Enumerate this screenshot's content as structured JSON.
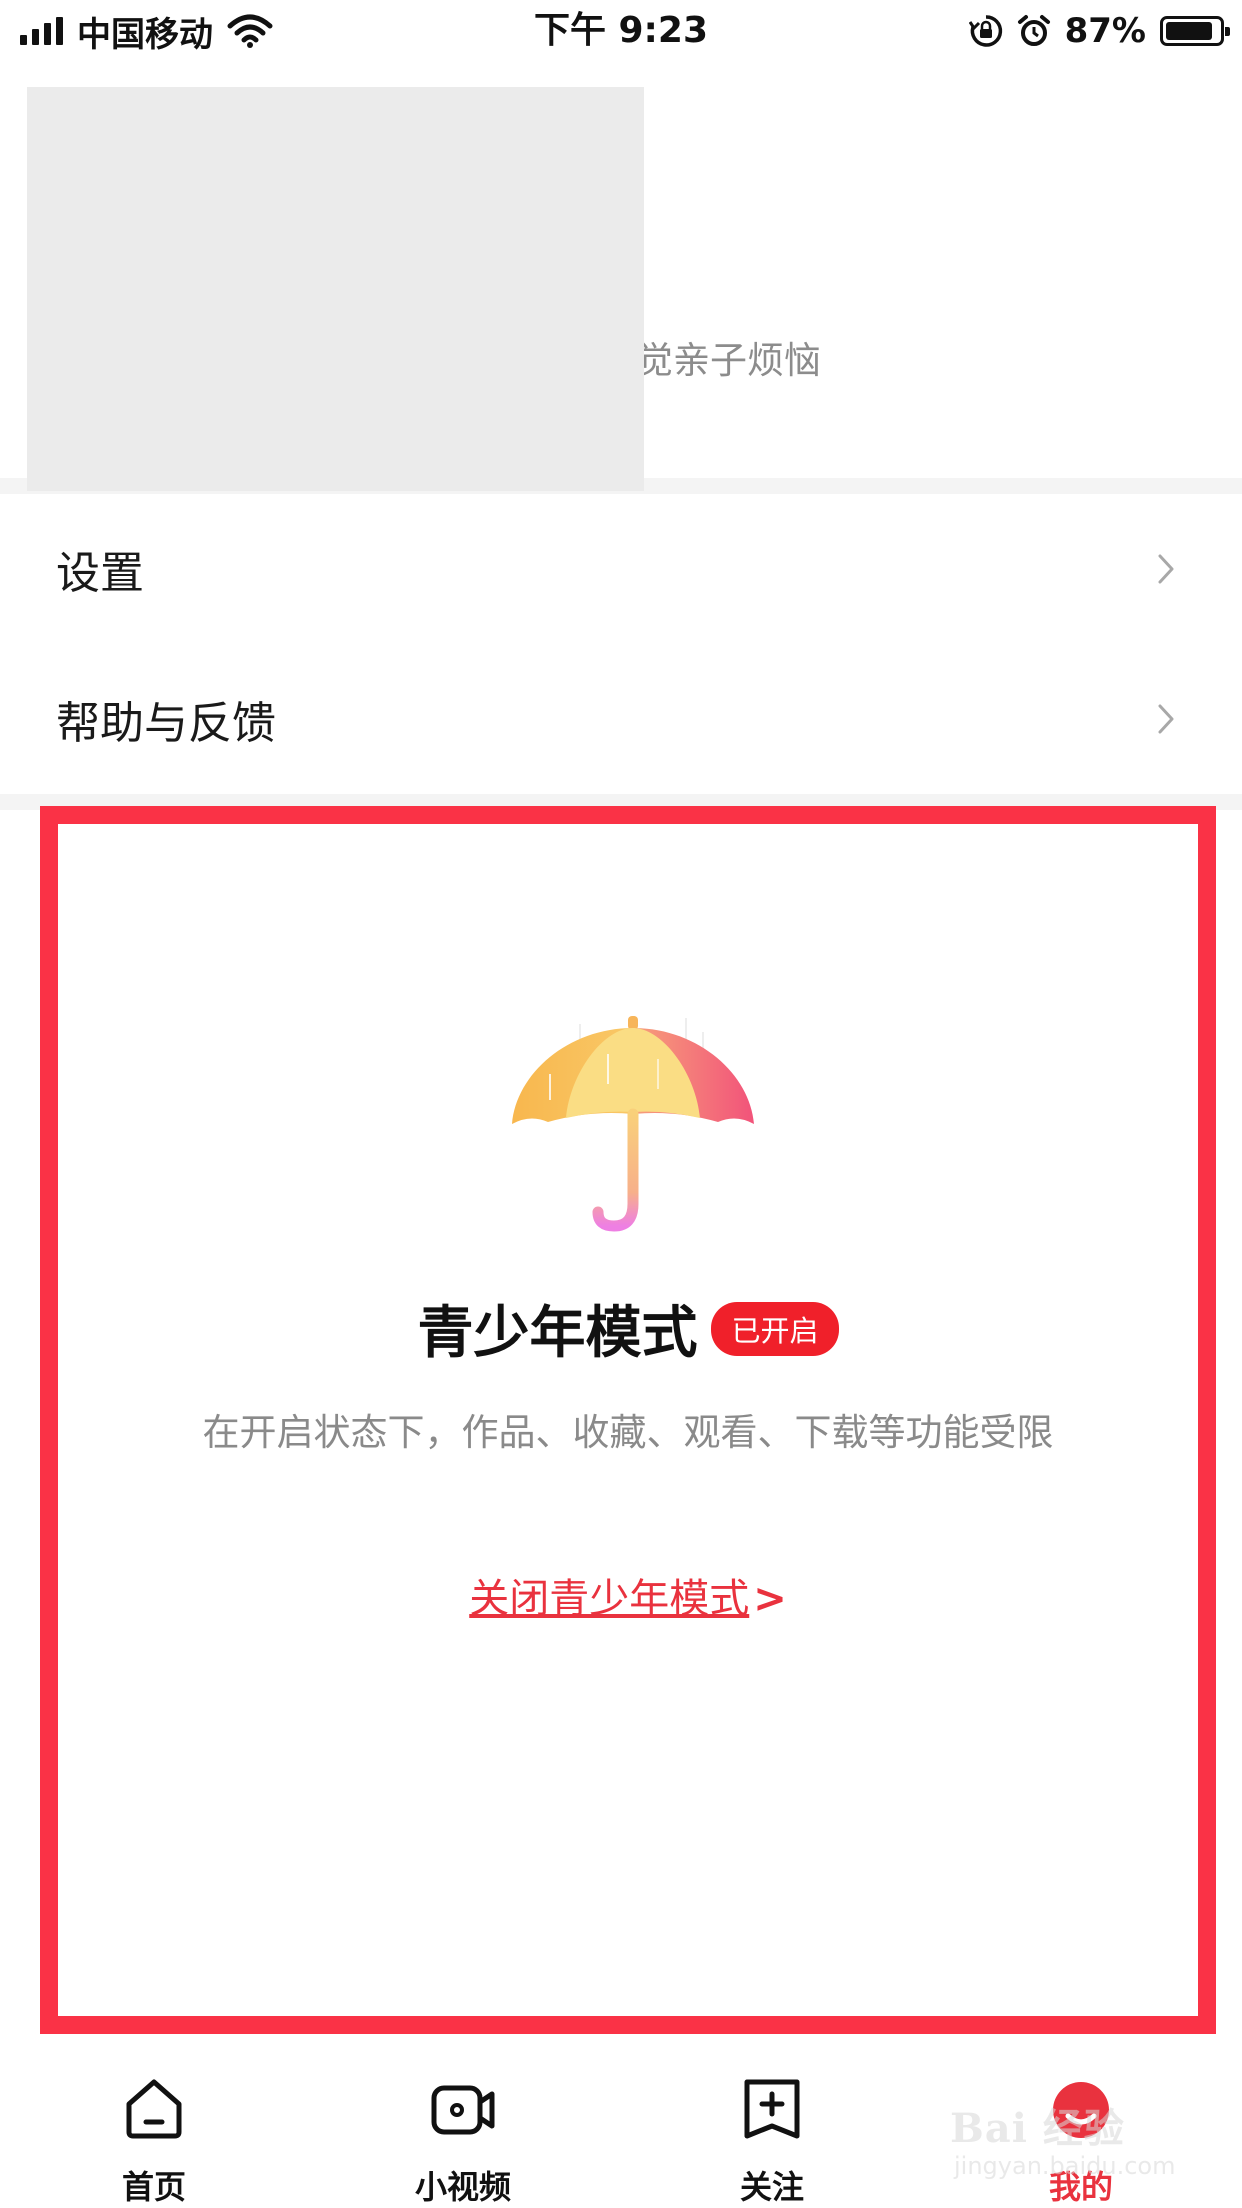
{
  "status_bar": {
    "carrier": "中国移动",
    "time": "下午 9:23",
    "battery_percent": "87%",
    "battery_level": 0.87,
    "icons": [
      "signal-icon",
      "wifi-icon",
      "orientation-lock-icon",
      "alarm-icon",
      "battery-icon"
    ]
  },
  "profile": {
    "bio_visible_text": "觉亲子烦恼"
  },
  "menu": {
    "items": [
      {
        "label": "设置",
        "icon": "chevron-right-icon"
      },
      {
        "label": "帮助与反馈",
        "icon": "chevron-right-icon"
      }
    ]
  },
  "teen_mode": {
    "icon": "umbrella-icon",
    "title": "青少年模式",
    "badge": "已开启",
    "description": "在开启状态下，作品、收藏、观看、下载等功能受限",
    "close_link": "关闭青少年模式",
    "close_arrow": ">",
    "highlight_color": "#fa3246"
  },
  "tabbar": {
    "tabs": [
      {
        "label": "首页",
        "icon": "home-icon",
        "active": false
      },
      {
        "label": "小视频",
        "icon": "video-camera-icon",
        "active": false
      },
      {
        "label": "关注",
        "icon": "follow-add-icon",
        "active": false
      },
      {
        "label": "我的",
        "icon": "profile-icon",
        "active": true
      }
    ],
    "active_color": "#e9323e"
  },
  "watermark": {
    "brand": "Bai 经验",
    "domain": "jingyan.baidu.com"
  }
}
